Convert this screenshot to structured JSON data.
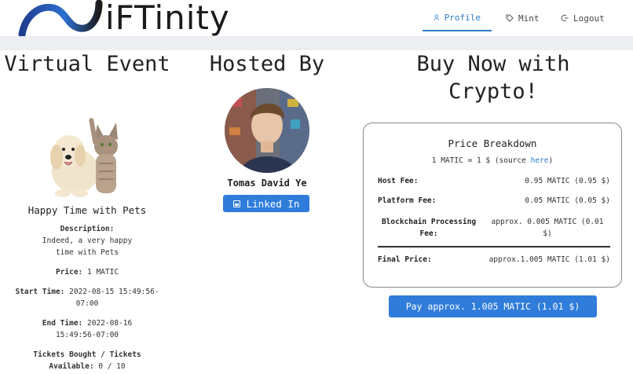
{
  "brand": {
    "name": "iFTinity"
  },
  "nav": {
    "items": [
      {
        "label": "Profile",
        "icon": "user-icon",
        "active": true
      },
      {
        "label": "Mint",
        "icon": "tag-icon",
        "active": false
      },
      {
        "label": "Logout",
        "icon": "logout-icon",
        "active": false
      }
    ]
  },
  "event": {
    "section_title": "Virtual Event",
    "name": "Happy Time with Pets",
    "description_label": "Description:",
    "description": "Indeed, a very happy time with Pets",
    "price_label": "Price:",
    "price": "1 MATIC",
    "start_label": "Start Time:",
    "start": "2022-08-15 15:49:56-07:00",
    "end_label": "End Time:",
    "end": "2022-08-16 15:49:56-07:00",
    "tickets_label": "Tickets Bought / Tickets Available:",
    "tickets": "0 / 10"
  },
  "host": {
    "section_title": "Hosted By",
    "name": "Tomas David Ye",
    "linkedin_label": "Linked In"
  },
  "buy": {
    "section_title": "Buy Now with Crypto!",
    "breakdown_title": "Price Breakdown",
    "rate_text": "1 MATIC = 1 $ (source ",
    "rate_link": "here",
    "rate_close": ")",
    "rows": [
      {
        "label": "Host Fee:",
        "value": "0.95 MATIC (0.95 $)"
      },
      {
        "label": "Platform Fee:",
        "value": "0.05 MATIC (0.05 $)"
      },
      {
        "label": "Blockchain Processing Fee:",
        "value": "approx. 0.005 MATIC (0.01 $)"
      }
    ],
    "final_label": "Final Price:",
    "final_value": "approx.1.005 MATIC (1.01 $)",
    "pay_label": "Pay approx. 1.005 MATIC (1.01 $)"
  },
  "colors": {
    "accent": "#2f7cdb",
    "link": "#2f7cc9",
    "band": "#eceef2"
  }
}
